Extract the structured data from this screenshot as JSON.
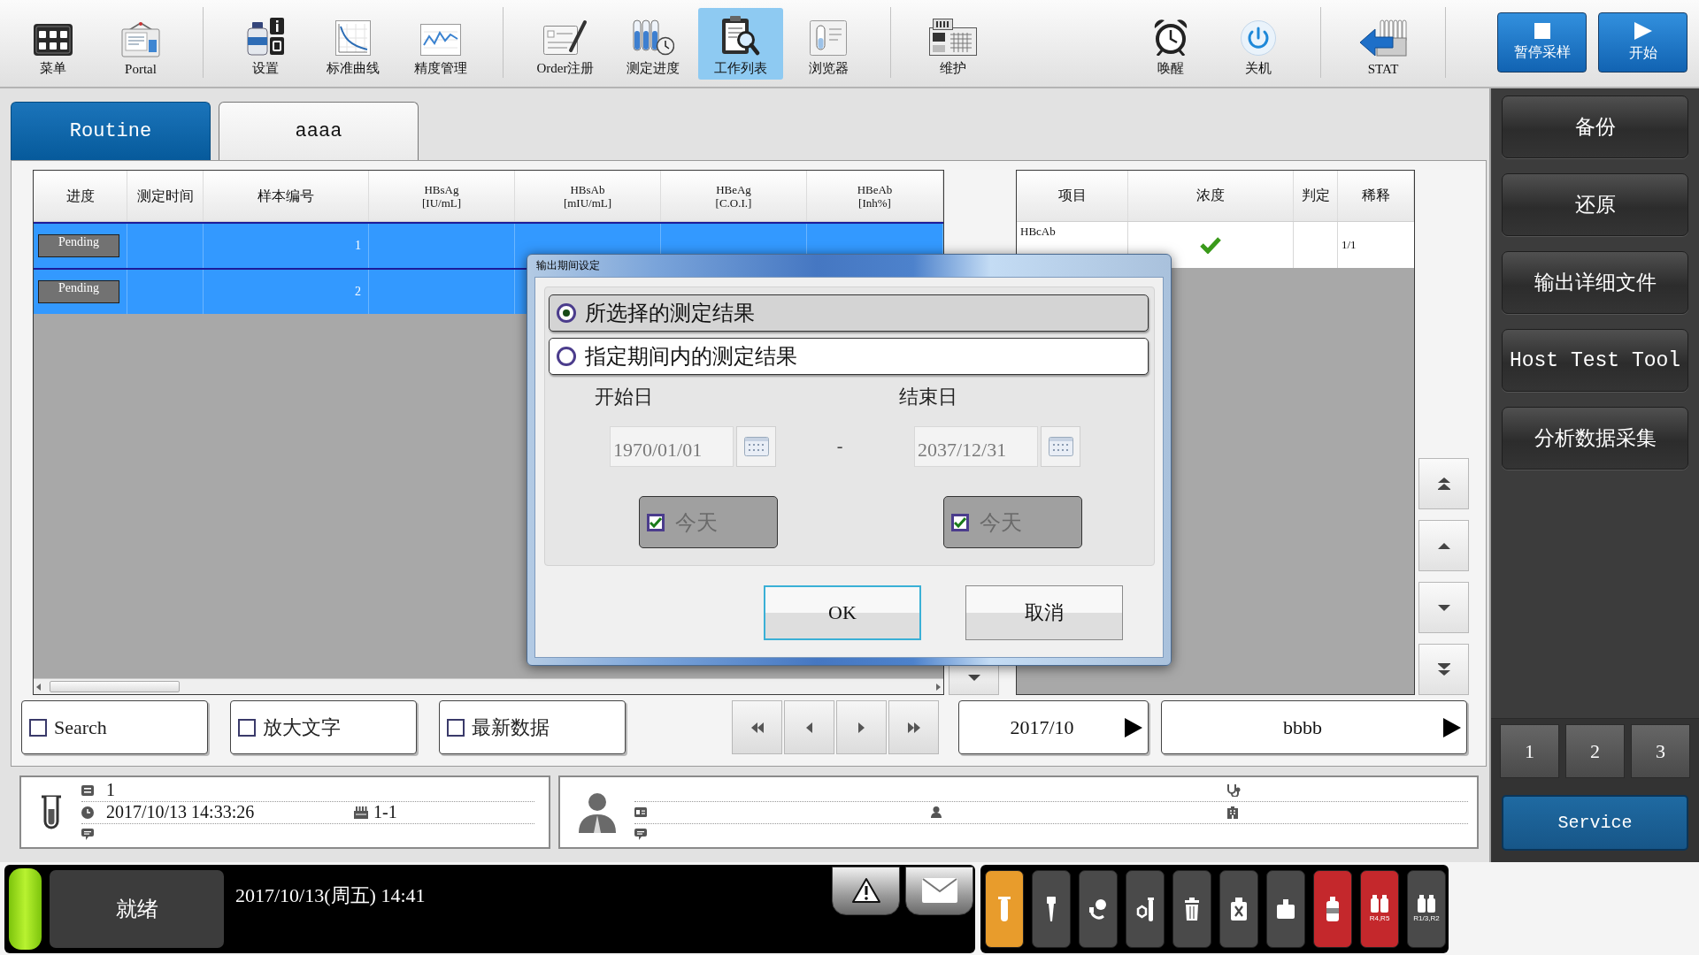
{
  "toolbar": {
    "left_groups": [
      {
        "items": [
          {
            "label": "菜单",
            "selected": false
          },
          {
            "label": "Portal",
            "selected": false
          }
        ]
      },
      {
        "items": [
          {
            "label": "设置",
            "selected": false
          },
          {
            "label": "标准曲线",
            "selected": false
          },
          {
            "label": "精度管理",
            "selected": false
          }
        ]
      },
      {
        "items": [
          {
            "label": "Order注册",
            "selected": false
          },
          {
            "label": "测定进度",
            "selected": false
          },
          {
            "label": "工作列表",
            "selected": true
          },
          {
            "label": "浏览器",
            "selected": false
          }
        ]
      },
      {
        "items": [
          {
            "label": "维护",
            "selected": false
          }
        ]
      }
    ],
    "right_groups": [
      {
        "items": [
          {
            "label": "唤醒",
            "selected": false
          },
          {
            "label": "关机",
            "selected": false
          }
        ]
      },
      {
        "items": [
          {
            "label": "STAT",
            "selected": false
          }
        ]
      }
    ],
    "actions": [
      {
        "label": "暂停采样"
      },
      {
        "label": "开始"
      }
    ]
  },
  "tabs": [
    {
      "label": "Routine",
      "selected": true
    },
    {
      "label": "aaaa",
      "selected": false
    }
  ],
  "sample_table": {
    "columns": [
      {
        "label": "进度"
      },
      {
        "label": "测定时间"
      },
      {
        "label": "样本编号"
      },
      {
        "label": "HBsAg",
        "unit": "[IU/mL]"
      },
      {
        "label": "HBsAb",
        "unit": "[mIU/mL]"
      },
      {
        "label": "HBeAg",
        "unit": "[C.O.I.]"
      },
      {
        "label": "HBeAb",
        "unit": "[Inh%]"
      }
    ],
    "rows": [
      {
        "status": "Pending",
        "sample_no": "1",
        "selected": true
      },
      {
        "status": "Pending",
        "sample_no": "2",
        "selected": true
      }
    ]
  },
  "result_table": {
    "columns": [
      {
        "label": "项目"
      },
      {
        "label": "浓度"
      },
      {
        "label": "判定"
      },
      {
        "label": "稀释"
      }
    ],
    "rows": [
      {
        "item": "HBcAb",
        "checked": true,
        "dilution": "1/1"
      }
    ]
  },
  "filters": [
    {
      "label": "Search",
      "checked": false
    },
    {
      "label": "放大文字",
      "checked": false
    },
    {
      "label": "最新数据",
      "checked": false
    }
  ],
  "month_selector": {
    "value": "2017/10"
  },
  "list_selector": {
    "value": "bbbb"
  },
  "sample_info": {
    "number": "1",
    "datetime": "2017/10/13 14:33:26",
    "rack_position": "1-1"
  },
  "side_menu": {
    "buttons": [
      {
        "label": "备份"
      },
      {
        "label": "还原"
      },
      {
        "label": "输出详细文件"
      },
      {
        "label": "Host Test Tool"
      },
      {
        "label": "分析数据采集"
      }
    ],
    "pages": [
      {
        "label": "1"
      },
      {
        "label": "2"
      },
      {
        "label": "3"
      }
    ],
    "service": {
      "label": "Service"
    }
  },
  "status_bar": {
    "light_on": true,
    "status": "就绪",
    "datetime": "2017/10/13(周五) 14:41",
    "reagents": [
      {
        "kind": "tube",
        "color": "#e89c2c"
      },
      {
        "kind": "tip",
        "color": "#4a4a4a"
      },
      {
        "kind": "mixer",
        "color": "#4a4a4a"
      },
      {
        "kind": "cleaner",
        "color": "#4a4a4a"
      },
      {
        "kind": "waste",
        "color": "#4a4a4a"
      },
      {
        "kind": "cuvette",
        "color": "#4a4a4a"
      },
      {
        "kind": "pack",
        "color": "#4a4a4a"
      },
      {
        "kind": "bottle",
        "color": "#c4282c"
      },
      {
        "kind": "bottle-pair",
        "color": "#c4282c",
        "label": "R4,R5"
      },
      {
        "kind": "bottle-pair",
        "color": "#4a4a4a",
        "label": "R1/3,R2"
      }
    ]
  },
  "dialog": {
    "title": "输出期间设定",
    "options": [
      {
        "label": "所选择的测定结果",
        "selected": true
      },
      {
        "label": "指定期间内的测定结果",
        "selected": false
      }
    ],
    "start": {
      "label": "开始日",
      "value": "1970/01/01",
      "disabled": true,
      "today": {
        "label": "今天",
        "checked": true
      }
    },
    "range_separator": "-",
    "end": {
      "label": "结束日",
      "value": "2037/12/31",
      "disabled": true,
      "today": {
        "label": "今天",
        "checked": true
      }
    },
    "buttons": [
      {
        "label": "OK",
        "focused": true
      },
      {
        "label": "取消",
        "focused": false
      }
    ]
  }
}
